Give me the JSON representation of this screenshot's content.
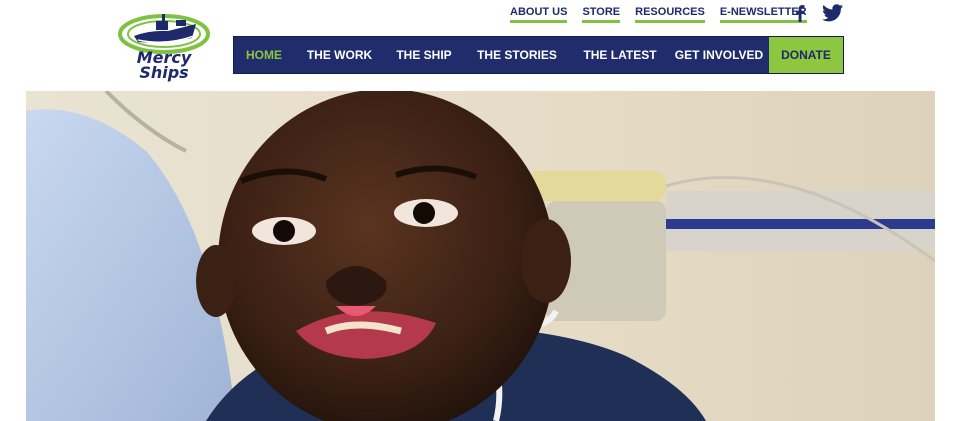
{
  "brand": {
    "logo_line1": "Mercy",
    "logo_line2": "Ships",
    "colors": {
      "navy": "#202c6c",
      "green": "#8dc63f"
    }
  },
  "top_links": [
    {
      "label": "ABOUT US"
    },
    {
      "label": "STORE"
    },
    {
      "label": "RESOURCES"
    },
    {
      "label": "E-NEWSLETTER"
    }
  ],
  "social": [
    {
      "icon": "facebook-icon"
    },
    {
      "icon": "twitter-icon"
    }
  ],
  "nav": {
    "items": [
      {
        "label": "HOME",
        "active": true
      },
      {
        "label": "THE WORK"
      },
      {
        "label": "THE SHIP"
      },
      {
        "label": "THE STORIES"
      },
      {
        "label": "THE LATEST"
      },
      {
        "label": "GET INVOLVED"
      }
    ],
    "donate_label": "DONATE"
  },
  "hero": {
    "image": "smiling-child-photo"
  }
}
